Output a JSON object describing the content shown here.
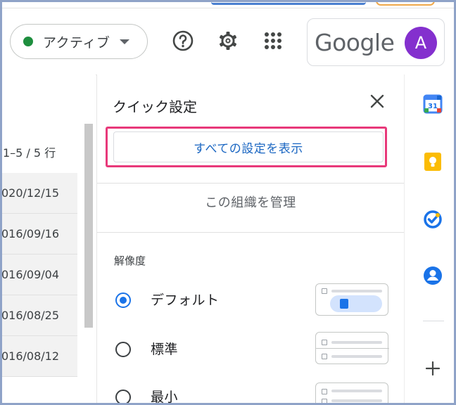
{
  "header": {
    "status_label": "アクティブ",
    "account_logo": "Google",
    "avatar_letter": "A",
    "icons": [
      "help-circle-icon",
      "gear-icon",
      "apps-grid-icon"
    ]
  },
  "list": {
    "pager": "1–5 / 5 行",
    "dates": [
      "020/12/15",
      "016/09/16",
      "016/09/04",
      "016/08/25",
      "016/08/12"
    ]
  },
  "quick_settings": {
    "title": "クイック設定",
    "all_settings_label": "すべての設定を表示",
    "manage_org_label": "この組織を管理",
    "density_section": "解像度",
    "density_options": [
      {
        "label": "デフォルト",
        "selected": true
      },
      {
        "label": "標準",
        "selected": false
      },
      {
        "label": "最小",
        "selected": false
      }
    ]
  },
  "rail": {
    "apps": [
      "google-calendar-icon",
      "google-keep-icon",
      "google-tasks-icon",
      "google-contacts-icon"
    ],
    "add_icon": "plus-icon"
  },
  "colors": {
    "highlight": "#e8397a",
    "link_blue": "#1a66c2",
    "active_green": "#1e8e3e",
    "avatar": "#8430ce"
  }
}
